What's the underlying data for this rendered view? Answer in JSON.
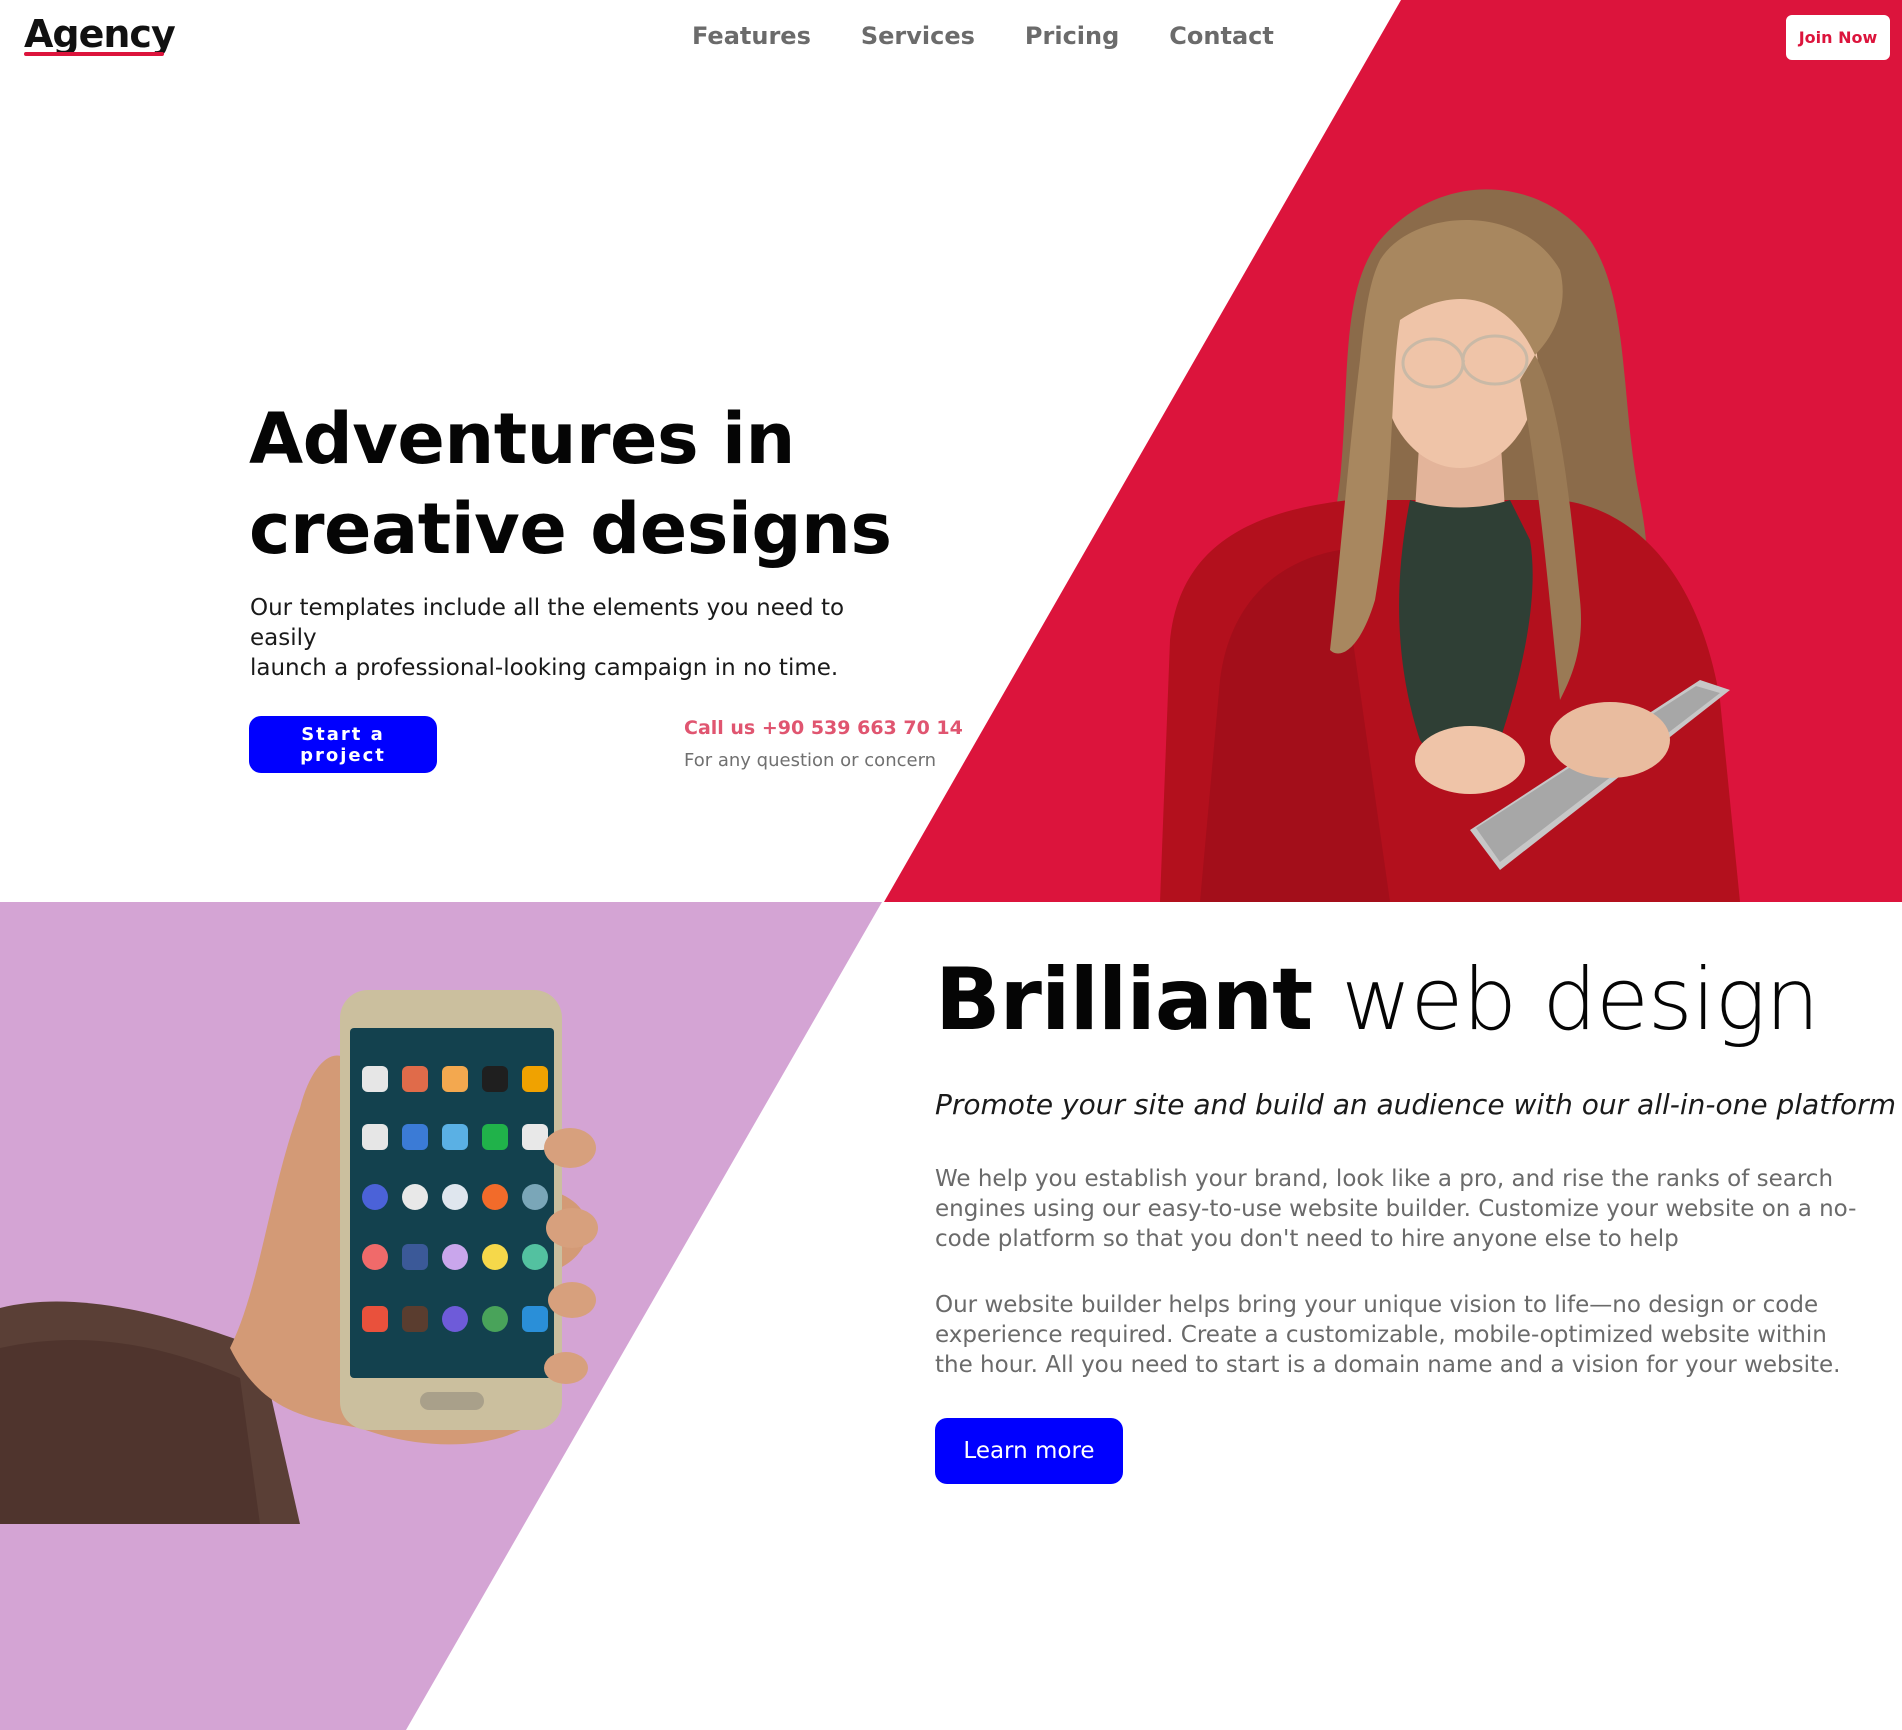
{
  "brand": {
    "logo": "Agency",
    "accent_color": "#dc143c",
    "primary_color": "#0000ff",
    "lavender_color": "#d4a4d4"
  },
  "nav": {
    "items": [
      {
        "label": "Features"
      },
      {
        "label": "Services"
      },
      {
        "label": "Pricing"
      },
      {
        "label": "Contact"
      }
    ],
    "cta": "Join Now"
  },
  "hero": {
    "title_line1": "Adventures in",
    "title_line2": "creative designs",
    "subtitle_line1": "Our templates include all the elements you need to easily",
    "subtitle_line2": "launch a professional-looking campaign in no time.",
    "cta": "Start a project",
    "call_label": "Call us +90 539 663 70 14",
    "call_note": "For any question or concern",
    "image": "woman-with-tablet"
  },
  "feature": {
    "title_bold": "Brilliant",
    "title_light": "web design",
    "lead": "Promote your site and build an audience with our all-in-one platform",
    "paragraph1": "We help you establish your brand, look like a pro, and rise the ranks of search engines using our easy-to-use website builder. Customize your website on a no-code platform so that you don't need to hire anyone else to help",
    "paragraph2": "Our website builder helps bring your unique vision to life—no design or code experience required. Create a customizable, mobile-optimized website within the hour. All you need to start is a domain name and a vision for your website.",
    "cta": "Learn more",
    "image": "hand-holding-smartphone"
  }
}
